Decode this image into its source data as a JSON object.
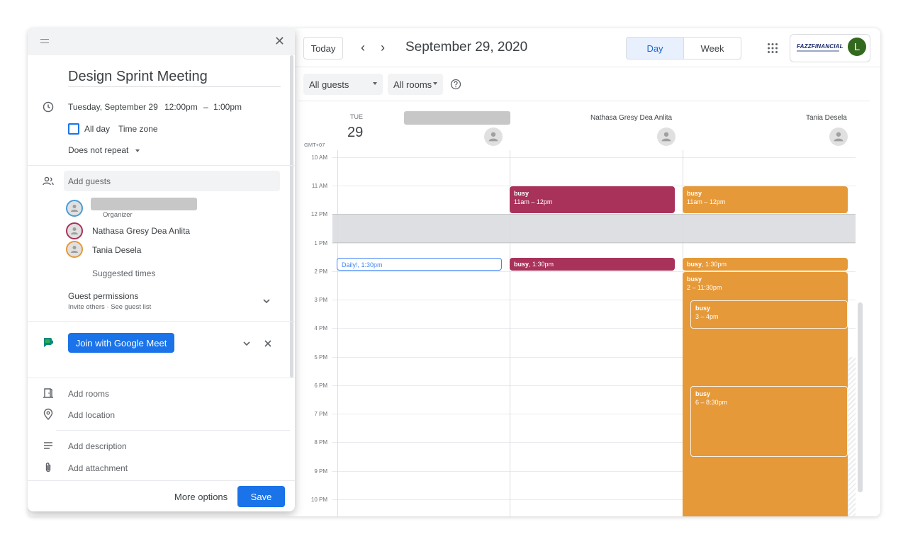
{
  "panel": {
    "title": "Design Sprint Meeting",
    "date_text": "Tuesday, September 29",
    "start_time": "12:00pm",
    "dash": "–",
    "end_time": "1:00pm",
    "all_day_label": "All day",
    "time_zone_label": "Time zone",
    "repeat_label": "Does not repeat",
    "add_guests_placeholder": "Add guests",
    "organizer_label": "Organizer",
    "guests": [
      {
        "name": "Nathasa Gresy Dea Anlita",
        "color": "#a8325a"
      },
      {
        "name": "Tania Desela",
        "color": "#e69938"
      }
    ],
    "organizer_color": "#4a9cd6",
    "suggested_times": "Suggested times",
    "guest_permissions_title": "Guest permissions",
    "guest_permissions_sub": "Invite others · See guest list",
    "meet_button": "Join with Google Meet",
    "add_rooms": "Add rooms",
    "add_location": "Add location",
    "add_description": "Add description",
    "add_attachment": "Add attachment",
    "more_options": "More options",
    "save": "Save"
  },
  "header": {
    "today": "Today",
    "date_title": "September 29, 2020",
    "view_day": "Day",
    "view_week": "Week",
    "brand": "FAZZFINANCIAL",
    "user_initial": "L"
  },
  "filters": {
    "guests": "All guests",
    "rooms": "All rooms"
  },
  "day": {
    "weekday": "TUE",
    "number": "29",
    "timezone": "GMT+07",
    "columns": [
      "",
      "Nathasa Gresy Dea Anlita",
      "Tania Desela"
    ]
  },
  "hours": [
    "10 AM",
    "11 AM",
    "12 PM",
    "1 PM",
    "2 PM",
    "3 PM",
    "4 PM",
    "5 PM",
    "6 PM",
    "7 PM",
    "8 PM",
    "9 PM",
    "10 PM"
  ],
  "events": {
    "n_busy_1": {
      "title": "busy",
      "time": "11am – 12pm"
    },
    "t_busy_1": {
      "title": "busy",
      "time": "11am – 12pm"
    },
    "daily": {
      "title": "Daily!",
      "time": ", 1:30pm"
    },
    "n_busy_2": {
      "title": "busy",
      "time": ", 1:30pm"
    },
    "t_busy_2": {
      "title": "busy",
      "time": ", 1:30pm"
    },
    "t_busy_3": {
      "title": "busy",
      "time": "2 – 11:30pm"
    },
    "t_busy_4": {
      "title": "busy",
      "time": "3 – 4pm"
    },
    "t_busy_5": {
      "title": "busy",
      "time": "6 – 8:30pm"
    }
  },
  "colors": {
    "accent": "#1a73e8",
    "crimson": "#a8325a",
    "orange": "#e69938",
    "avatar_green": "#33691e"
  }
}
